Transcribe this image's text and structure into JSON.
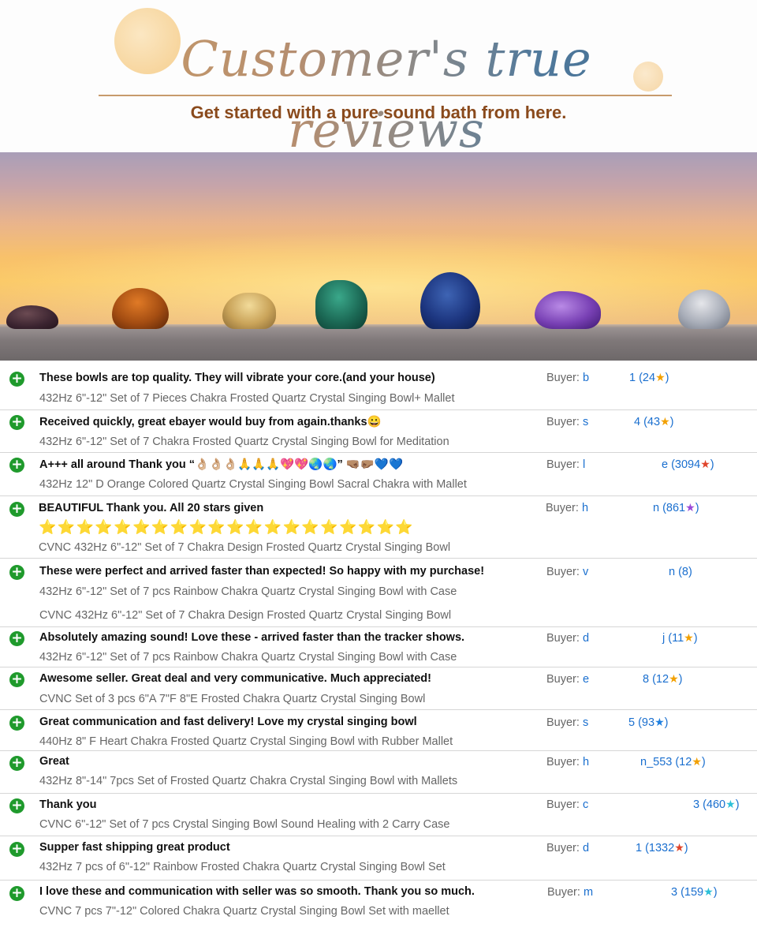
{
  "header": {
    "title": "Customer's true reviews",
    "subtitle": "Get started with a pure sound bath from here."
  },
  "colors": {
    "plus_icon": "#1f9a2c",
    "link_blue": "#1a6fcf",
    "subtitle_brown": "#8a4a1c",
    "star_orange": "#f2a000",
    "star_red": "#e0442a",
    "star_purple": "#9b4ad8",
    "star_blue": "#1e7fe0",
    "star_turquoise": "#2cc0d8"
  },
  "reviews": [
    {
      "comment": "These bowls are top quality. They will vibrate your core.(and your house)",
      "product": "432Hz 6\"-12\" Set of 7 Pieces Chakra Frosted Quartz Crystal Singing Bowl+ Mallet",
      "buyer_label": "Buyer:",
      "buyer": "b",
      "feedback_prefix": "1 (24",
      "feedback_suffix": ")",
      "star_icon": "star-orange-icon"
    },
    {
      "comment": "Received quickly, great ebayer would buy from again.thanks😀",
      "product": "432Hz 6\"-12\" Set of 7 Chakra Frosted Quartz Crystal Singing Bowl for Meditation",
      "buyer_label": "Buyer:",
      "buyer": "s",
      "feedback_prefix": "4 (43",
      "feedback_suffix": ")",
      "star_icon": "star-orange-icon"
    },
    {
      "comment": "A+++ all around Thank you “👌🏼👌🏼👌🏼🙏🙏🙏💖💖🌏🌏” 🤜🏽🤛🏽💙💙",
      "product": "432Hz 12\" D Orange Colored Quartz Crystal Singing Bowl Sacral Chakra with Mallet",
      "buyer_label": "Buyer:",
      "buyer": "l",
      "feedback_prefix": "e (3094",
      "feedback_suffix": ")",
      "star_icon": "star-red-icon"
    },
    {
      "comment": "BEAUTIFUL Thank you. All 20 stars given",
      "stars_line": "⭐⭐⭐⭐⭐⭐⭐⭐⭐⭐⭐⭐⭐⭐⭐⭐⭐⭐⭐⭐",
      "product": "CVNC 432Hz 6\"-12\" Set of 7 Chakra Design Frosted Quartz Crystal Singing Bowl",
      "buyer_label": "Buyer:",
      "buyer": "h",
      "feedback_prefix": "n (861",
      "feedback_suffix": ")",
      "star_icon": "star-purple-icon"
    },
    {
      "comment": "These were perfect and arrived faster than expected! So happy with my purchase!",
      "product": "432Hz 6\"-12\" Set of 7 pcs Rainbow Chakra Quartz Crystal Singing Bowl with Case",
      "product2": "CVNC 432Hz 6\"-12\" Set of 7 Chakra Design Frosted Quartz Crystal Singing Bowl",
      "buyer_label": "Buyer:",
      "buyer": "v",
      "feedback_prefix": "n (8)",
      "feedback_suffix": "",
      "star_icon": ""
    },
    {
      "comment": "Absolutely amazing sound! Love these - arrived faster than the tracker shows.",
      "product": "432Hz 6\"-12\" Set of 7 pcs Rainbow Chakra Quartz Crystal Singing Bowl with Case",
      "buyer_label": "Buyer:",
      "buyer": "d",
      "feedback_prefix": "j (11",
      "feedback_suffix": ")",
      "star_icon": "star-orange-icon"
    },
    {
      "comment": "Awesome seller. Great deal and very communicative. Much appreciated!",
      "product": "CVNC Set of 3 pcs 6\"A 7\"F 8\"E Frosted Chakra Quartz Crystal Singing Bowl",
      "buyer_label": "Buyer:",
      "buyer": "e",
      "feedback_prefix": "8 (12",
      "feedback_suffix": ")",
      "star_icon": "star-orange-icon"
    },
    {
      "comment": "Great communication and fast delivery! Love my crystal singing bowl",
      "product": "440Hz 8\" F Heart Chakra Frosted Quartz Crystal Singing Bowl with Rubber Mallet",
      "buyer_label": "Buyer:",
      "buyer": "s",
      "feedback_prefix": "5 (93",
      "feedback_suffix": ")",
      "star_icon": "star-blue-icon"
    },
    {
      "comment": "Great",
      "product": "432Hz 8\"-14\" 7pcs Set of Frosted Quartz Chakra Crystal Singing Bowl with Mallets",
      "buyer_label": "Buyer:",
      "buyer": "h",
      "feedback_prefix": "n_553 (12",
      "feedback_suffix": ")",
      "star_icon": "star-orange-icon"
    },
    {
      "comment": "Thank you",
      "product": "CVNC 6\"-12\" Set of 7 pcs Crystal Singing Bowl Sound Healing with 2 Carry Case",
      "buyer_label": "Buyer:",
      "buyer": "c",
      "feedback_prefix": "3 (460",
      "feedback_suffix": ")",
      "star_icon": "star-turquoise-icon"
    },
    {
      "comment": "Supper fast shipping great product",
      "product": "432Hz 7 pcs of 6\"-12\" Rainbow Frosted Chakra Quartz Crystal Singing Bowl Set",
      "buyer_label": "Buyer:",
      "buyer": "d",
      "feedback_prefix": "1 (1332",
      "feedback_suffix": ")",
      "star_icon": "star-red-icon"
    },
    {
      "comment": "I love these and communication with seller was so smooth. Thank you so much.",
      "product": "CVNC 7 pcs 7\"-12\" Colored Chakra Quartz Crystal Singing Bowl Set with maellet",
      "buyer_label": "Buyer:",
      "buyer": "m",
      "feedback_prefix": "3 (159",
      "feedback_suffix": ")",
      "star_icon": "star-turquoise-icon"
    }
  ]
}
